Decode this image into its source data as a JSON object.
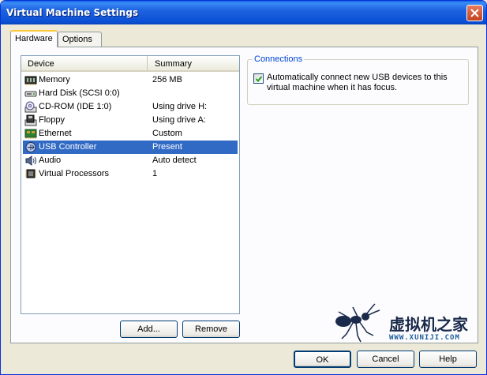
{
  "window": {
    "title": "Virtual Machine Settings"
  },
  "tabs": [
    {
      "label": "Hardware",
      "active": true
    },
    {
      "label": "Options",
      "active": false
    }
  ],
  "device_list": {
    "headers": {
      "device": "Device",
      "summary": "Summary"
    },
    "rows": [
      {
        "icon": "memory-icon",
        "device": "Memory",
        "summary": "256 MB"
      },
      {
        "icon": "hard-disk-icon",
        "device": "Hard Disk (SCSI 0:0)",
        "summary": ""
      },
      {
        "icon": "cdrom-icon",
        "device": "CD-ROM (IDE 1:0)",
        "summary": "Using drive H:"
      },
      {
        "icon": "floppy-icon",
        "device": "Floppy",
        "summary": "Using drive A:"
      },
      {
        "icon": "ethernet-icon",
        "device": "Ethernet",
        "summary": "Custom"
      },
      {
        "icon": "usb-icon",
        "device": "USB Controller",
        "summary": "Present",
        "selected": true
      },
      {
        "icon": "audio-icon",
        "device": "Audio",
        "summary": "Auto detect"
      },
      {
        "icon": "processor-icon",
        "device": "Virtual Processors",
        "summary": "1"
      }
    ]
  },
  "list_buttons": {
    "add": "Add...",
    "remove": "Remove"
  },
  "connections": {
    "legend": "Connections",
    "auto_connect_checked": true,
    "auto_connect_label": "Automatically connect new USB devices to this virtual machine when it has focus."
  },
  "watermark": {
    "chinese": "虚拟机之家",
    "url": "WWW.XUNIJI.COM"
  },
  "dialog_buttons": {
    "ok": "OK",
    "cancel": "Cancel",
    "help": "Help"
  },
  "colors": {
    "title_bar": "#0a4fd4",
    "selection": "#316ac5",
    "legend_text": "#0046d5",
    "close_button": "#c4421e"
  }
}
